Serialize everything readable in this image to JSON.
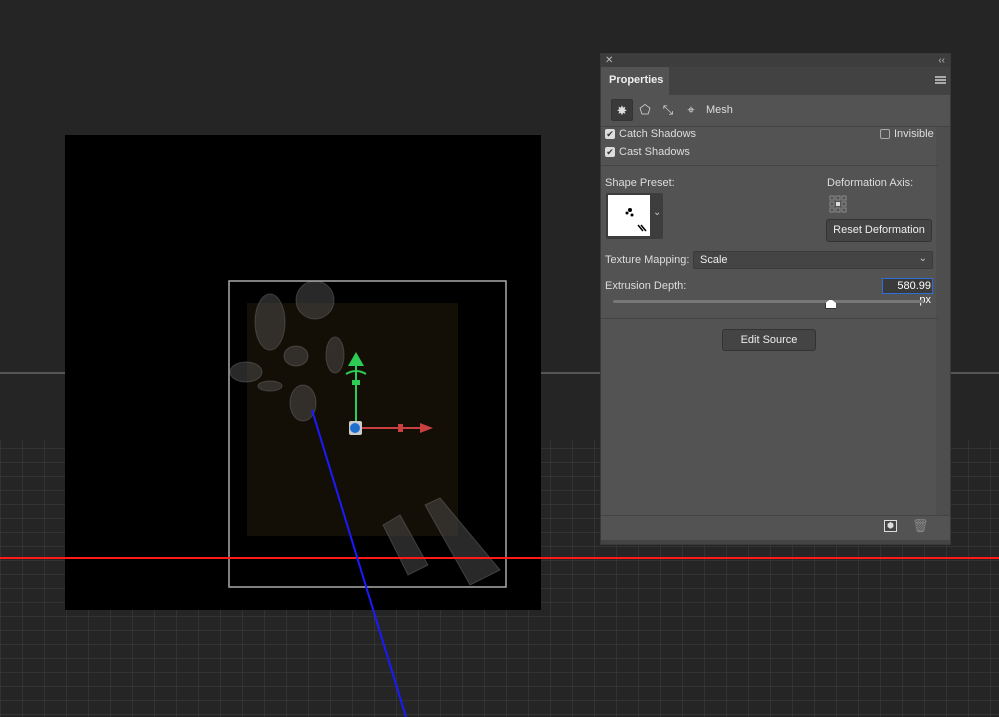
{
  "panel": {
    "title": "Properties",
    "close_icon": "close-icon",
    "collapse_icon": "double-chevron-left-icon",
    "menu_icon": "hamburger-menu-icon",
    "tabs_icons": [
      "mesh-icon",
      "deform-icon",
      "cap-icon",
      "coordinates-icon"
    ],
    "section_label": "Mesh",
    "catch_shadows": {
      "label": "Catch Shadows",
      "checked": true
    },
    "cast_shadows": {
      "label": "Cast Shadows",
      "checked": true
    },
    "invisible": {
      "label": "Invisible",
      "checked": false
    },
    "shape_preset_label": "Shape Preset:",
    "deformation_axis_label": "Deformation Axis:",
    "reset_deformation": "Reset Deformation",
    "texture_mapping_label": "Texture Mapping:",
    "texture_mapping_value": "Scale",
    "extrusion_depth_label": "Extrusion Depth:",
    "extrusion_depth_value": "580.99 px",
    "extrusion_slider_fraction": 0.7,
    "edit_source": "Edit Source",
    "footer_icons": [
      "render-icon",
      "trash-icon"
    ]
  },
  "colors": {
    "x_axis": "#e03a3a",
    "y_axis": "#2ecc55",
    "z_axis": "#1a1aff",
    "ground_line": "#ff1a1a",
    "focus": "#2d6fd6"
  }
}
